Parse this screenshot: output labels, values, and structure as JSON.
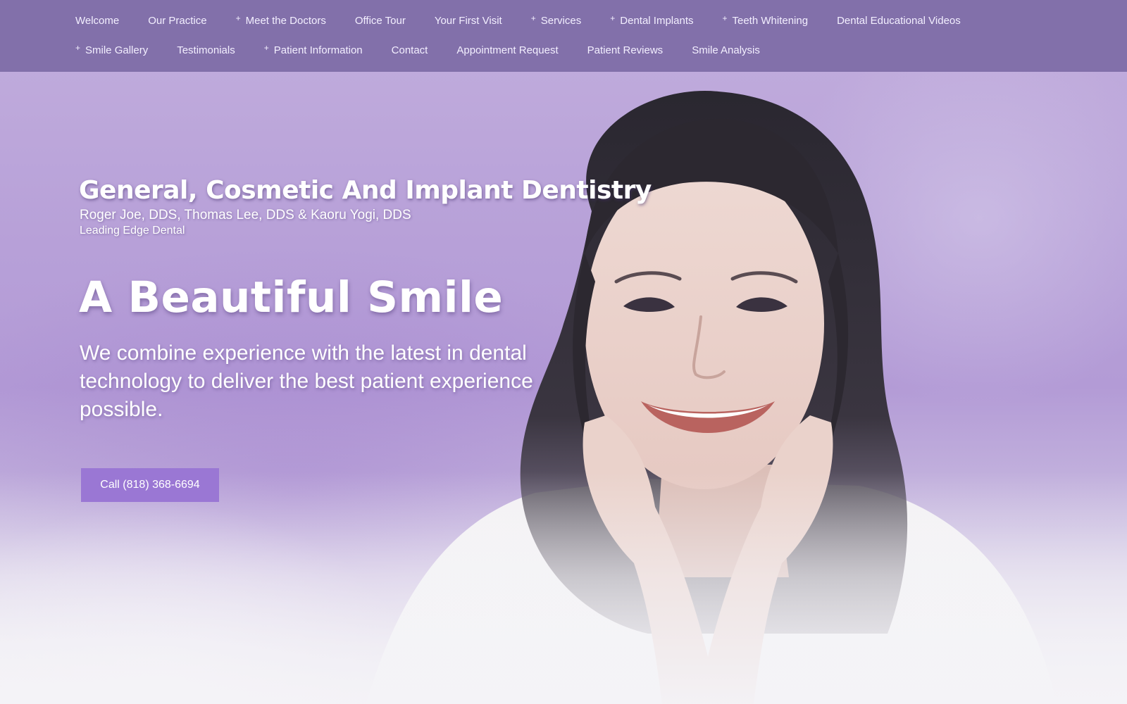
{
  "nav": {
    "row1": [
      {
        "label": "Welcome",
        "has_submenu": false
      },
      {
        "label": "Our Practice",
        "has_submenu": false
      },
      {
        "label": "Meet the Doctors",
        "has_submenu": true
      },
      {
        "label": "Office Tour",
        "has_submenu": false
      },
      {
        "label": "Your First Visit",
        "has_submenu": false
      },
      {
        "label": "Services",
        "has_submenu": true
      },
      {
        "label": "Dental Implants",
        "has_submenu": true
      },
      {
        "label": "Teeth Whitening",
        "has_submenu": true
      },
      {
        "label": "Dental Educational Videos",
        "has_submenu": false
      }
    ],
    "row2": [
      {
        "label": "Smile Gallery",
        "has_submenu": true
      },
      {
        "label": "Testimonials",
        "has_submenu": false
      },
      {
        "label": "Patient Information",
        "has_submenu": true
      },
      {
        "label": "Contact",
        "has_submenu": false
      },
      {
        "label": "Appointment Request",
        "has_submenu": false
      },
      {
        "label": "Patient Reviews",
        "has_submenu": false
      },
      {
        "label": "Smile Analysis",
        "has_submenu": false
      }
    ],
    "submenu_marker": "+"
  },
  "hero": {
    "practice_title": "General, Cosmetic And Implant Dentistry",
    "doctors": "Roger Joe, DDS, Thomas Lee, DDS & Kaoru Yogi, DDS",
    "practice_name": "Leading Edge Dental",
    "headline": "A Beautiful Smile",
    "tagline": "We combine experience with the latest in dental technology to deliver the best patient experience possible.",
    "cta_label": "Call (818) 368-6694",
    "image": "smiling-woman-photo"
  },
  "colors": {
    "nav_bg": "#8270aa",
    "nav_text": "#f3efff",
    "hero_bg": "#b7a0d8",
    "button_bg": "#9a77d4",
    "text": "#ffffff"
  }
}
